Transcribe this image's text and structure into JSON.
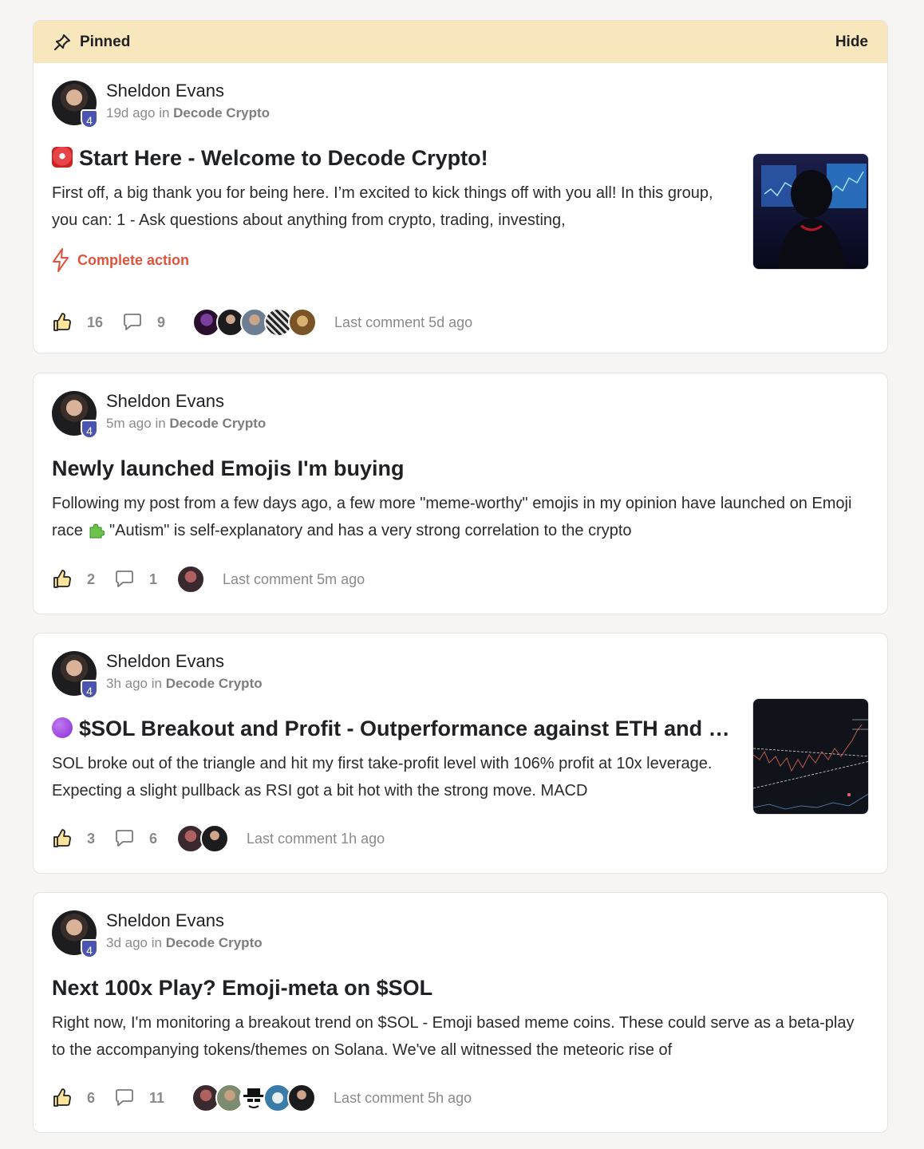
{
  "pinned": {
    "label": "Pinned",
    "hide": "Hide"
  },
  "posts": [
    {
      "author": "Sheldon Evans",
      "level": "4",
      "time": "19d ago",
      "in": "in",
      "group": "Decode Crypto",
      "title": "Start Here - Welcome to Decode Crypto!",
      "body": "First off, a big thank you for being here. I’m excited to kick things off with you all! In this group, you can: 1 - Ask questions about anything from crypto, trading, investing,",
      "action": "Complete action",
      "likes": "16",
      "comments": "9",
      "last_comment": "Last comment 5d ago"
    },
    {
      "author": "Sheldon Evans",
      "level": "4",
      "time": "5m ago",
      "in": "in",
      "group": "Decode Crypto",
      "title": "Newly launched Emojis I'm buying",
      "body_part1": "Following my post from a few days ago, a few more \"meme-worthy\" emojis in my opinion have launched on Emoji race",
      "body_part2": "\"Autism\" is self-explanatory and has a very strong correlation to the crypto",
      "likes": "2",
      "comments": "1",
      "last_comment": "Last comment 5m ago"
    },
    {
      "author": "Sheldon Evans",
      "level": "4",
      "time": "3h ago",
      "in": "in",
      "group": "Decode Crypto",
      "title": "$SOL Breakout and Profit - Outperformance against ETH and BTC",
      "body": "SOL broke out of the triangle and hit my first take-profit level with 106% profit at 10x leverage. Expecting a slight pullback as RSI got a bit hot with the strong move. MACD",
      "likes": "3",
      "comments": "6",
      "last_comment": "Last comment 1h ago"
    },
    {
      "author": "Sheldon Evans",
      "level": "4",
      "time": "3d ago",
      "in": "in",
      "group": "Decode Crypto",
      "title": "Next 100x Play? Emoji-meta on $SOL",
      "body": "Right now, I'm monitoring a breakout trend on $SOL - Emoji based meme coins. These could serve as a beta-play to the accompanying tokens/themes on Solana. We've all witnessed the meteoric rise of",
      "likes": "6",
      "comments": "11",
      "last_comment": "Last comment 5h ago"
    }
  ],
  "colors": {
    "accent_action": "#e0533d",
    "pinned_bg": "#f8e7bd",
    "badge": "#4b55b0"
  }
}
